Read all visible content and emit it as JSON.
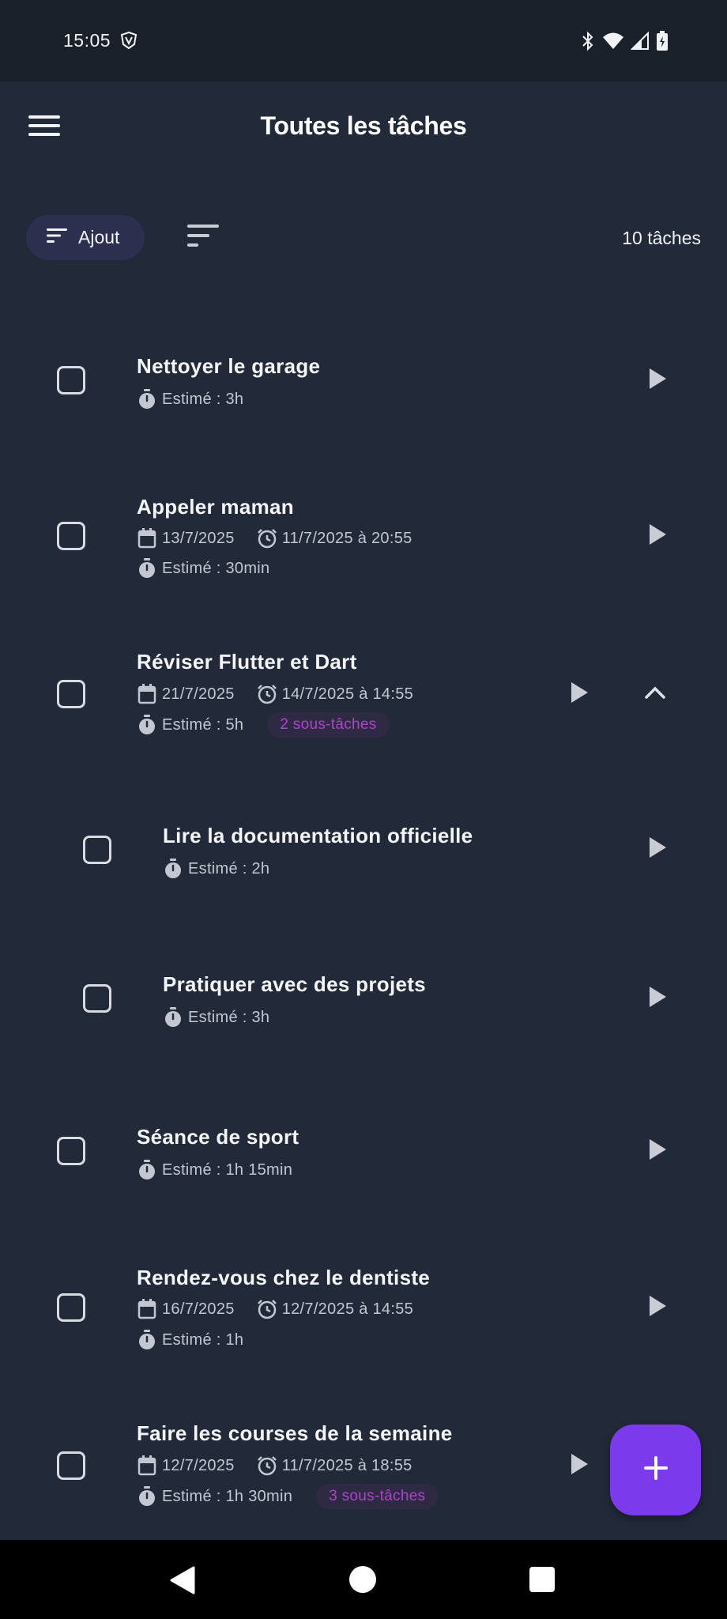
{
  "status_bar": {
    "time": "15:05"
  },
  "app_bar": {
    "title": "Toutes les tâches"
  },
  "toolbar": {
    "sort_label": "Ajout",
    "count": "10 tâches"
  },
  "tasks": [
    {
      "title": "Nettoyer le garage",
      "estimate": "Estimé : 3h"
    },
    {
      "title": "Appeler maman",
      "due_date": "13/7/2025",
      "reminder": "11/7/2025 à 20:55",
      "estimate": "Estimé : 30min"
    },
    {
      "title": "Réviser Flutter et Dart",
      "due_date": "21/7/2025",
      "reminder": "14/7/2025 à 14:55",
      "estimate": "Estimé : 5h",
      "subtasks_badge": "2 sous-tâches",
      "expanded": true,
      "subtasks": [
        {
          "title": "Lire la documentation officielle",
          "estimate": "Estimé : 2h"
        },
        {
          "title": "Pratiquer avec des projets",
          "estimate": "Estimé : 3h"
        }
      ]
    },
    {
      "title": "Séance de sport",
      "estimate": "Estimé : 1h 15min"
    },
    {
      "title": "Rendez-vous chez le dentiste",
      "due_date": "16/7/2025",
      "reminder": "12/7/2025 à 14:55",
      "estimate": "Estimé : 1h"
    },
    {
      "title": "Faire les courses de la semaine",
      "due_date": "12/7/2025",
      "reminder": "11/7/2025 à 18:55",
      "estimate": "Estimé : 1h 30min",
      "subtasks_badge": "3 sous-tâches"
    }
  ],
  "icons": {
    "menu": "menu-icon",
    "sort": "sort-icon",
    "checkbox": "checkbox-icon",
    "calendar": "calendar-icon",
    "alarm": "alarm-icon",
    "timer": "timer-icon",
    "play": "play-icon",
    "chevron_up": "chevron-up-icon",
    "add": "add-icon"
  },
  "colors": {
    "background": "#222938",
    "accent": "#7c3aed",
    "badge_text": "#b23fd0"
  }
}
